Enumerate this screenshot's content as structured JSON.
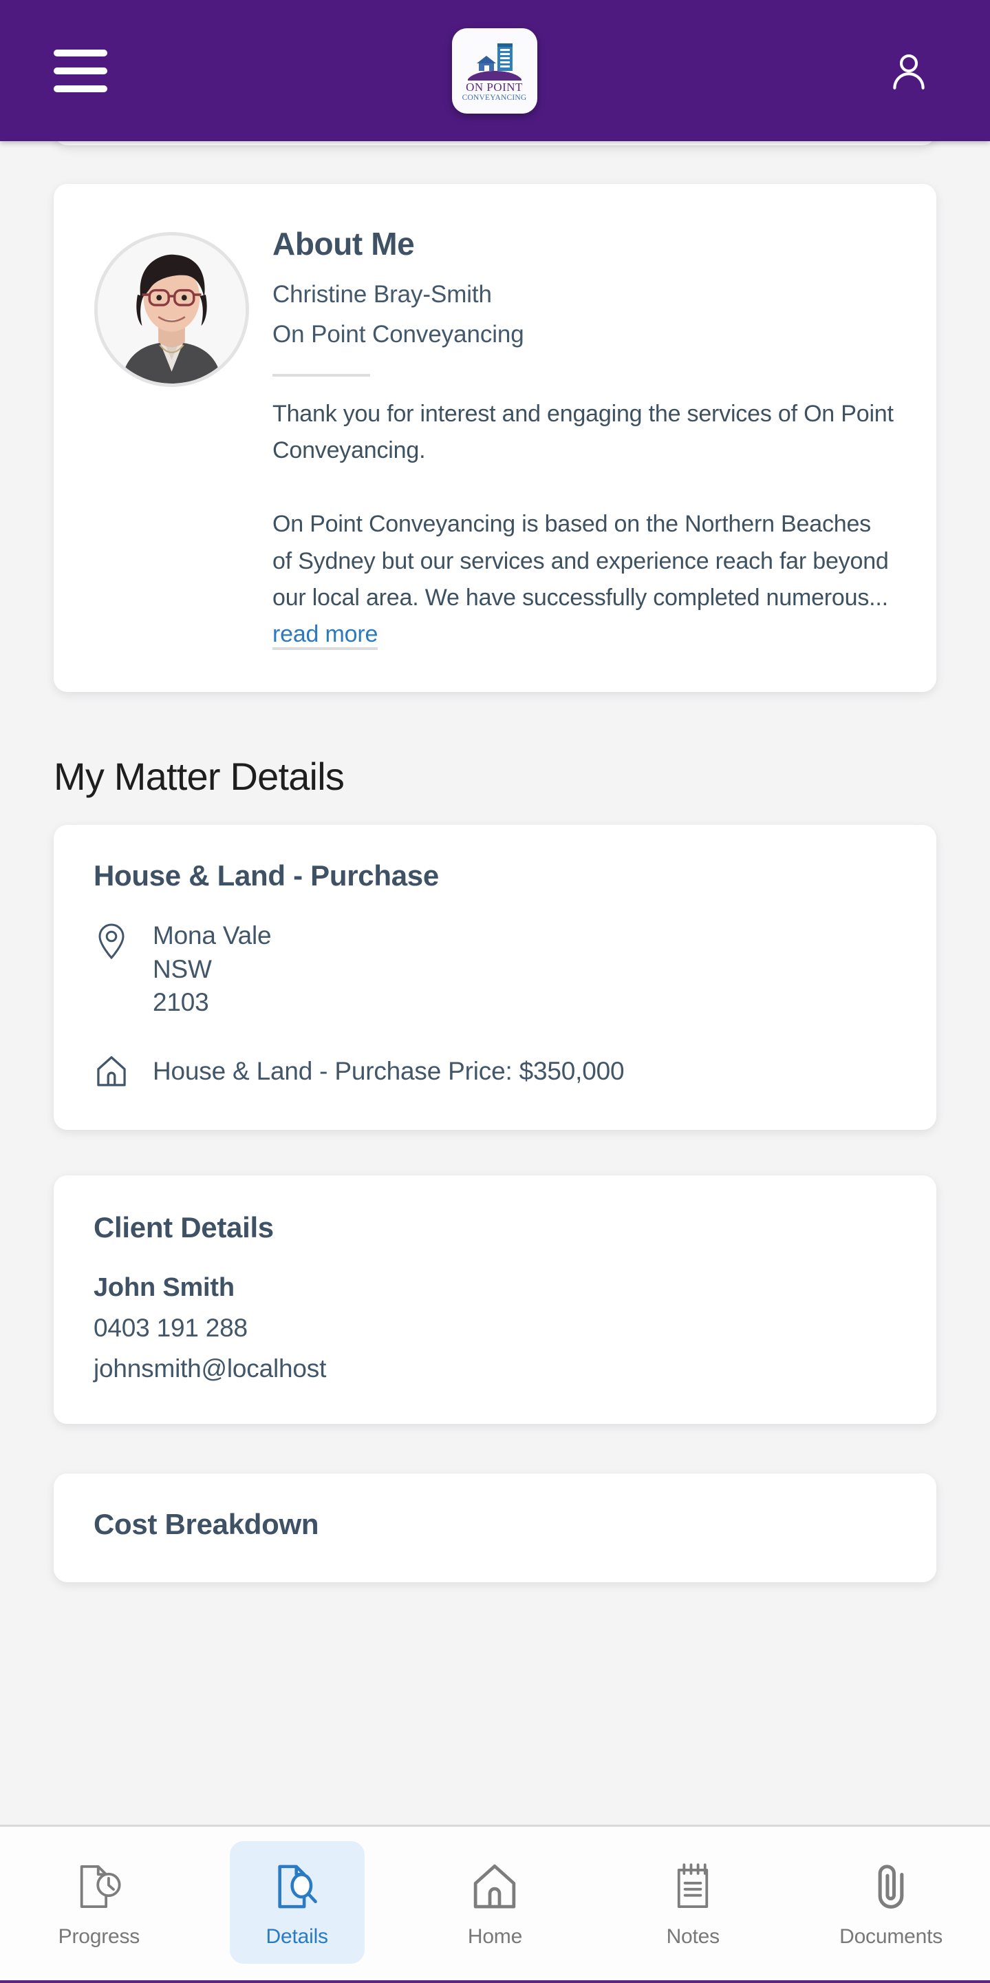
{
  "header": {
    "menu_icon": "hamburger-menu-icon",
    "logo": {
      "icon": "building-house-logo-icon",
      "line1": "ON POINT",
      "line2": "CONVEYANCING"
    },
    "account_icon": "person-account-icon"
  },
  "about": {
    "avatar_icon": "profile-photo",
    "title": "About Me",
    "name": "Christine Bray-Smith",
    "company": "On Point Conveyancing",
    "paragraph1": "Thank you for interest and engaging the services of On Point Conveyancing.",
    "paragraph2": "On Point Conveyancing is based on the Northern Beaches of Sydney but our services and experience reach far beyond our local area.  We have successfully completed numerous...",
    "read_more": "read more"
  },
  "section": {
    "heading": "My Matter Details"
  },
  "matter": {
    "title": "House & Land - Purchase",
    "location_icon": "map-pin-icon",
    "address_line1": "Mona Vale",
    "address_line2": "NSW",
    "address_line3": "2103",
    "house_icon": "house-icon",
    "price_text": "House & Land - Purchase Price: $350,000"
  },
  "client": {
    "title": "Client Details",
    "name": "John Smith",
    "phone": "0403 191 288",
    "email": "johnsmith@localhost"
  },
  "cost": {
    "title": "Cost Breakdown"
  },
  "bottom_nav": {
    "items": [
      {
        "label": "Progress",
        "icon": "document-clock-icon",
        "active": false
      },
      {
        "label": "Details",
        "icon": "document-search-icon",
        "active": true
      },
      {
        "label": "Home",
        "icon": "house-icon",
        "active": false
      },
      {
        "label": "Notes",
        "icon": "notepad-icon",
        "active": false
      },
      {
        "label": "Documents",
        "icon": "paperclip-icon",
        "active": false
      }
    ]
  },
  "colors": {
    "brand_purple": "#4e1a7f",
    "accent_blue": "#2a7ac4",
    "active_tab_bg": "#e3effb",
    "text_slate": "#42566a",
    "page_bg": "#f4f4f5"
  }
}
